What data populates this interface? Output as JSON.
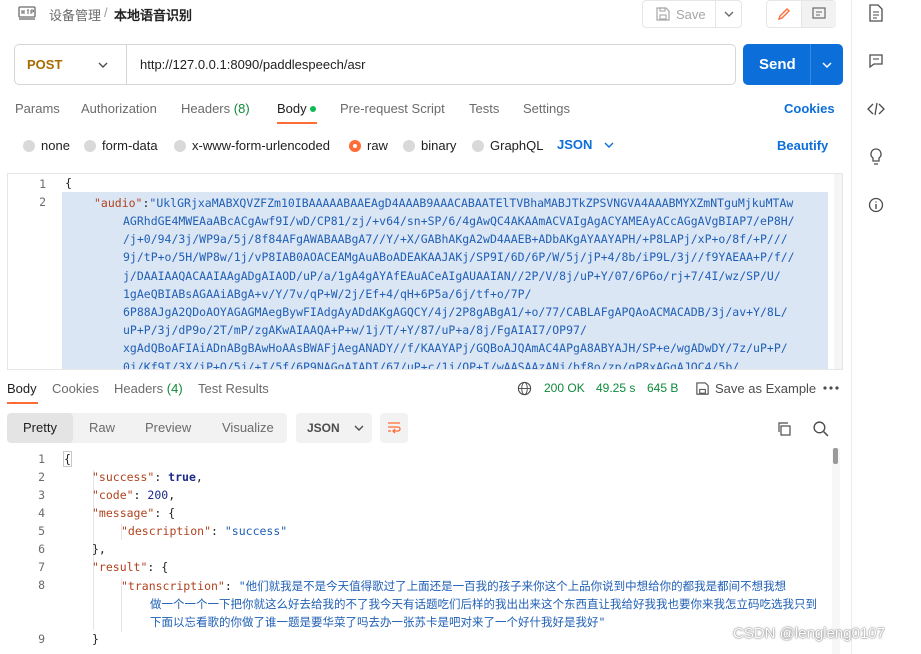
{
  "breadcrumb": {
    "parent": "设备管理",
    "separator": "/",
    "current": "本地语音识别"
  },
  "toolbar": {
    "save_label": "Save"
  },
  "request": {
    "method": "POST",
    "url": "http://127.0.0.1:8090/paddlespeech/asr",
    "send_label": "Send"
  },
  "request_tabs": {
    "params": "Params",
    "authorization": "Authorization",
    "headers": "Headers",
    "headers_count": "(8)",
    "body": "Body",
    "prerequest": "Pre-request Script",
    "tests": "Tests",
    "settings": "Settings",
    "cookies": "Cookies"
  },
  "body_types": {
    "none": "none",
    "form_data": "form-data",
    "urlencoded": "x-www-form-urlencoded",
    "raw": "raw",
    "binary": "binary",
    "graphql": "GraphQL",
    "format": "JSON",
    "beautify": "Beautify"
  },
  "request_editor": {
    "line_numbers": [
      "1",
      "2"
    ],
    "line1": "{",
    "audio_key": "\"audio\"",
    "audio_colon": ":",
    "audio_first": "\"UklGRjxaMABXQVZFZm10IBAAAAABAAEAgD4AAAB9AAACABAATElTVBhaMABJTkZPSVNGVA4AAABMYXZmNTguMjkuMTAw",
    "audio_lines": [
      "AGRhdGE4MWEAaABcACgAwf9I/wD/CP81/zj/+v64/sn+SP/6/4gAwQC4AKAAmACVAIgAgACYAMEAyACcAGgAVgBIAP7/eP8H/",
      "/j+0/94/3j/WP9a/5j/8f84AFgAWABAABgA7//Y/+X/GABhAKgA2wD4AAEB+ADbAKgAYAAYAPH/+P8LAPj/xP+o/8f/+P///",
      "9j/tP+o/5H/WP8w/1j/vP8IAB0AOACEAMgAuABoADEAKAAJAKj/SP9I/6D/6P/W/5j/jP+4/8b/iP9L/3j//f9YAEAA+P/f//",
      "j/DAAIAAQACAAIAAgADgAIAOD/uP/a/1gA4gAYAfEAuACeAIgAUAAIAN//2P/V/8j/uP+Y/07/6P6o/rj+7/4I/wz/SP/U/",
      "1gAeQBIABsAGAAiABgA+v/Y/7v/qP+W/2j/Ef+4/qH+6P5a/6j/tf+o/7P/",
      "6P88AJgA2QDoAOYAGAGMAegBywFIAdgAyADdAKgAGQCY/4j/2P8gABgA1/+o/77/CABLAFgAPQAoACMACADB/3j/av+Y/8L/",
      "uP+P/3j/dP9o/2T/mP/zgAKwAIAAQA+P+w/1j/T/+Y/87/uP+a/8j/FgAIAI7/OP97/",
      "xgAdQBoAFIAiADnABgBAwHoAAsBWAFjAegANADY//f/KAAYAPj/GQBoAJQAmAC4APgA8ABYAJH/SP+e/wgADwDY/7z/uP+P/",
      "0j/Kf9I/3X/iP+Q/5j/+I/5f/6P9NAGgAIADI/67/uP+c/1j/OP+I/wAASAAzANj/bf8o/zp/qP8xAGgAJQC4/5b/"
    ]
  },
  "response_tabs": {
    "body": "Body",
    "cookies": "Cookies",
    "headers": "Headers",
    "headers_count": "(4)",
    "test_results": "Test Results"
  },
  "response_meta": {
    "status": "200 OK",
    "time": "49.25 s",
    "size": "645 B",
    "save_example": "Save as Example"
  },
  "response_views": {
    "pretty": "Pretty",
    "raw": "Raw",
    "preview": "Preview",
    "visualize": "Visualize",
    "format": "JSON"
  },
  "response_body": {
    "line_numbers": [
      "1",
      "2",
      "3",
      "4",
      "5",
      "6",
      "7",
      "8",
      "9"
    ],
    "open": "{",
    "success_key": "\"success\"",
    "success_val": "true",
    "code_key": "\"code\"",
    "code_val": "200",
    "message_key": "\"message\"",
    "description_key": "\"description\"",
    "description_val": "\"success\"",
    "result_key": "\"result\"",
    "transcription_key": "\"transcription\"",
    "transcription_val_1": "\"他们就我是不是今天值得歌过了上面还是一百我的孩子来你这个上品你说到中想给你的都我是都间不想我想",
    "transcription_val_2": "做一个一个一下把你就这么好去给我的不了我今天有话题吃们后样的我出出来这个东西直让我给好我我也要你来我怎立码吃选我只到",
    "transcription_val_3": "下面以忘看歌的你做了谁一题是要华菜了吗去办一张苏卡是吧对来了一个好什我好是我好\"",
    "close_inner": "}"
  },
  "watermark": "CSDN @lengleng0107"
}
